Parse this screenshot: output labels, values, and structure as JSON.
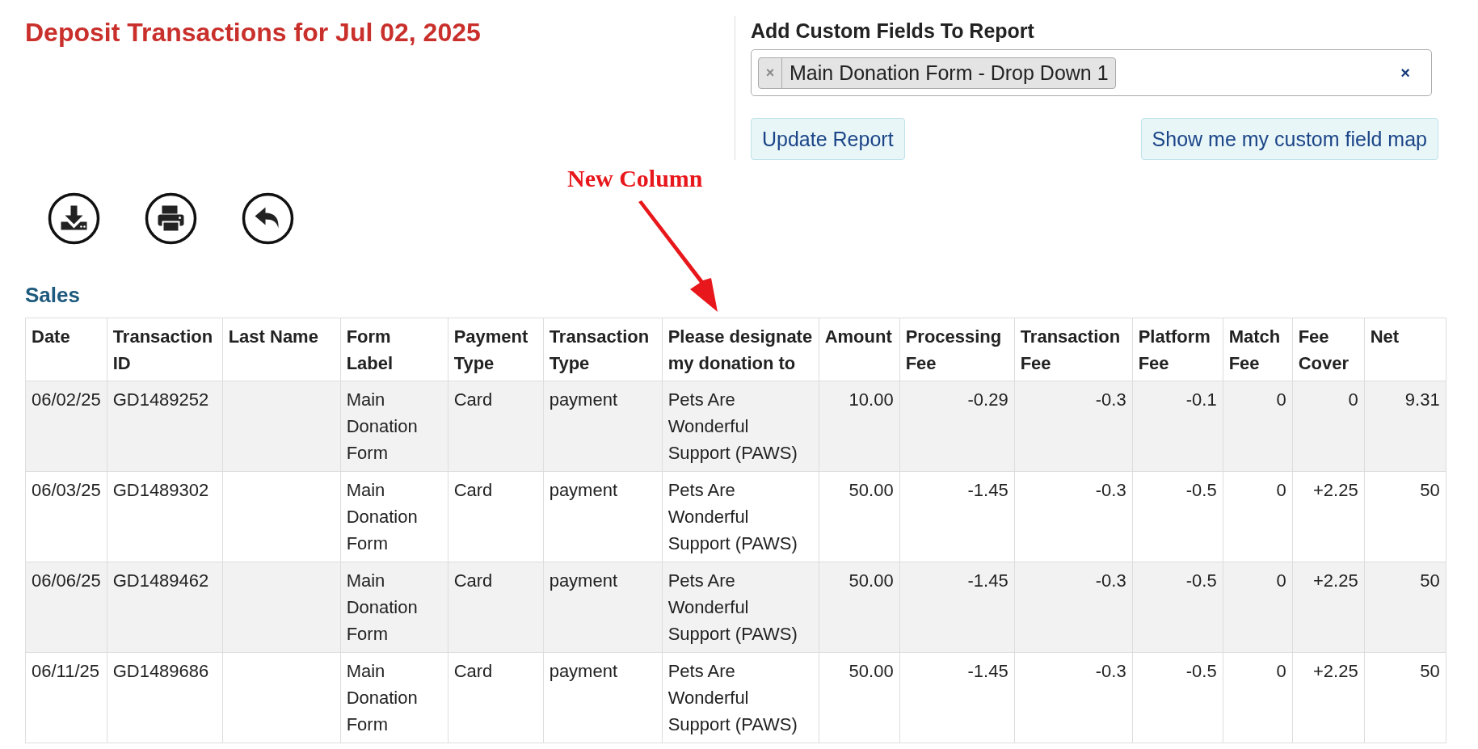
{
  "title": "Deposit Transactions for Jul 02, 2025",
  "custom_fields": {
    "label": "Add Custom Fields To Report",
    "tags": [
      {
        "label": "Main Donation Form - Drop Down 1",
        "remove": "×"
      }
    ],
    "clear": "×",
    "buttons": [
      {
        "label": "Update Report"
      },
      {
        "label": "Show me my custom field map"
      }
    ]
  },
  "toolbar": [
    {
      "kind": "download"
    },
    {
      "kind": "print"
    },
    {
      "kind": "back"
    }
  ],
  "annotation": {
    "text": "New Column"
  },
  "section": "Sales",
  "table": {
    "columns": [
      {
        "label": "Date",
        "kind": "text"
      },
      {
        "label": "Transaction ID",
        "kind": "text"
      },
      {
        "label": "Last Name",
        "kind": "text"
      },
      {
        "label": "Form Label",
        "kind": "text"
      },
      {
        "label": "Payment Type",
        "kind": "text"
      },
      {
        "label": "Transaction Type",
        "kind": "text"
      },
      {
        "label": "Please designate my donation to",
        "kind": "text"
      },
      {
        "label": "Amount",
        "kind": "number"
      },
      {
        "label": "Processing Fee",
        "kind": "number"
      },
      {
        "label": "Transaction Fee",
        "kind": "number"
      },
      {
        "label": "Platform Fee",
        "kind": "number"
      },
      {
        "label": "Match Fee",
        "kind": "number"
      },
      {
        "label": "Fee Cover",
        "kind": "number"
      },
      {
        "label": "Net",
        "kind": "number"
      }
    ],
    "rows": [
      {
        "cells": [
          "06/02/25",
          "GD1489252",
          "",
          "Main Donation Form",
          "Card",
          "payment",
          "Pets Are Wonderful Support (PAWS)",
          "10.00",
          "-0.29",
          "-0.3",
          "-0.1",
          "0",
          "0",
          "9.31"
        ]
      },
      {
        "cells": [
          "06/03/25",
          "GD1489302",
          "",
          "Main Donation Form",
          "Card",
          "payment",
          "Pets Are Wonderful Support (PAWS)",
          "50.00",
          "-1.45",
          "-0.3",
          "-0.5",
          "0",
          "+2.25",
          "50"
        ]
      },
      {
        "cells": [
          "06/06/25",
          "GD1489462",
          "",
          "Main Donation Form",
          "Card",
          "payment",
          "Pets Are Wonderful Support (PAWS)",
          "50.00",
          "-1.45",
          "-0.3",
          "-0.5",
          "0",
          "+2.25",
          "50"
        ]
      },
      {
        "cells": [
          "06/11/25",
          "GD1489686",
          "",
          "Main Donation Form",
          "Card",
          "payment",
          "Pets Are Wonderful Support (PAWS)",
          "50.00",
          "-1.45",
          "-0.3",
          "-0.5",
          "0",
          "+2.25",
          "50"
        ]
      }
    ]
  }
}
